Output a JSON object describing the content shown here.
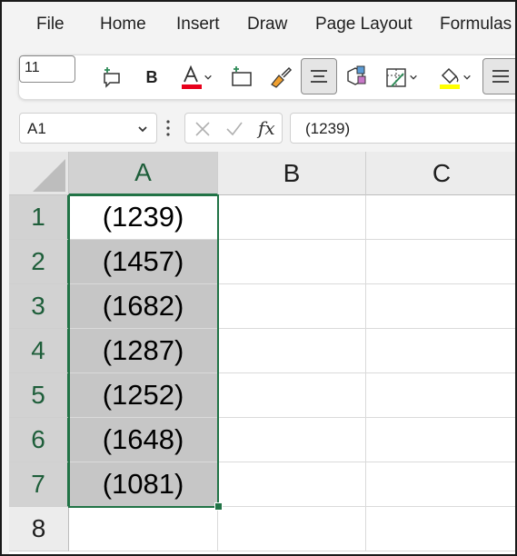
{
  "menu": {
    "tabs": [
      "File",
      "Home",
      "Insert",
      "Draw",
      "Page Layout",
      "Formulas"
    ]
  },
  "ribbon": {
    "font_size": "11",
    "bold_label": "B",
    "font_color": "#e8001c",
    "highlight_color": "#ffff00"
  },
  "formula_bar": {
    "name_box": "A1",
    "fx_label": "fx",
    "formula": "(1239)"
  },
  "sheet": {
    "columns": [
      "A",
      "B",
      "C"
    ],
    "rows": [
      "1",
      "2",
      "3",
      "4",
      "5",
      "6",
      "7",
      "8"
    ],
    "cells_a": [
      "(1239)",
      "(1457)",
      "(1682)",
      "(1287)",
      "(1252)",
      "(1648)",
      "(1081)",
      ""
    ],
    "selection": "A1:A7",
    "accent_color": "#217346"
  }
}
